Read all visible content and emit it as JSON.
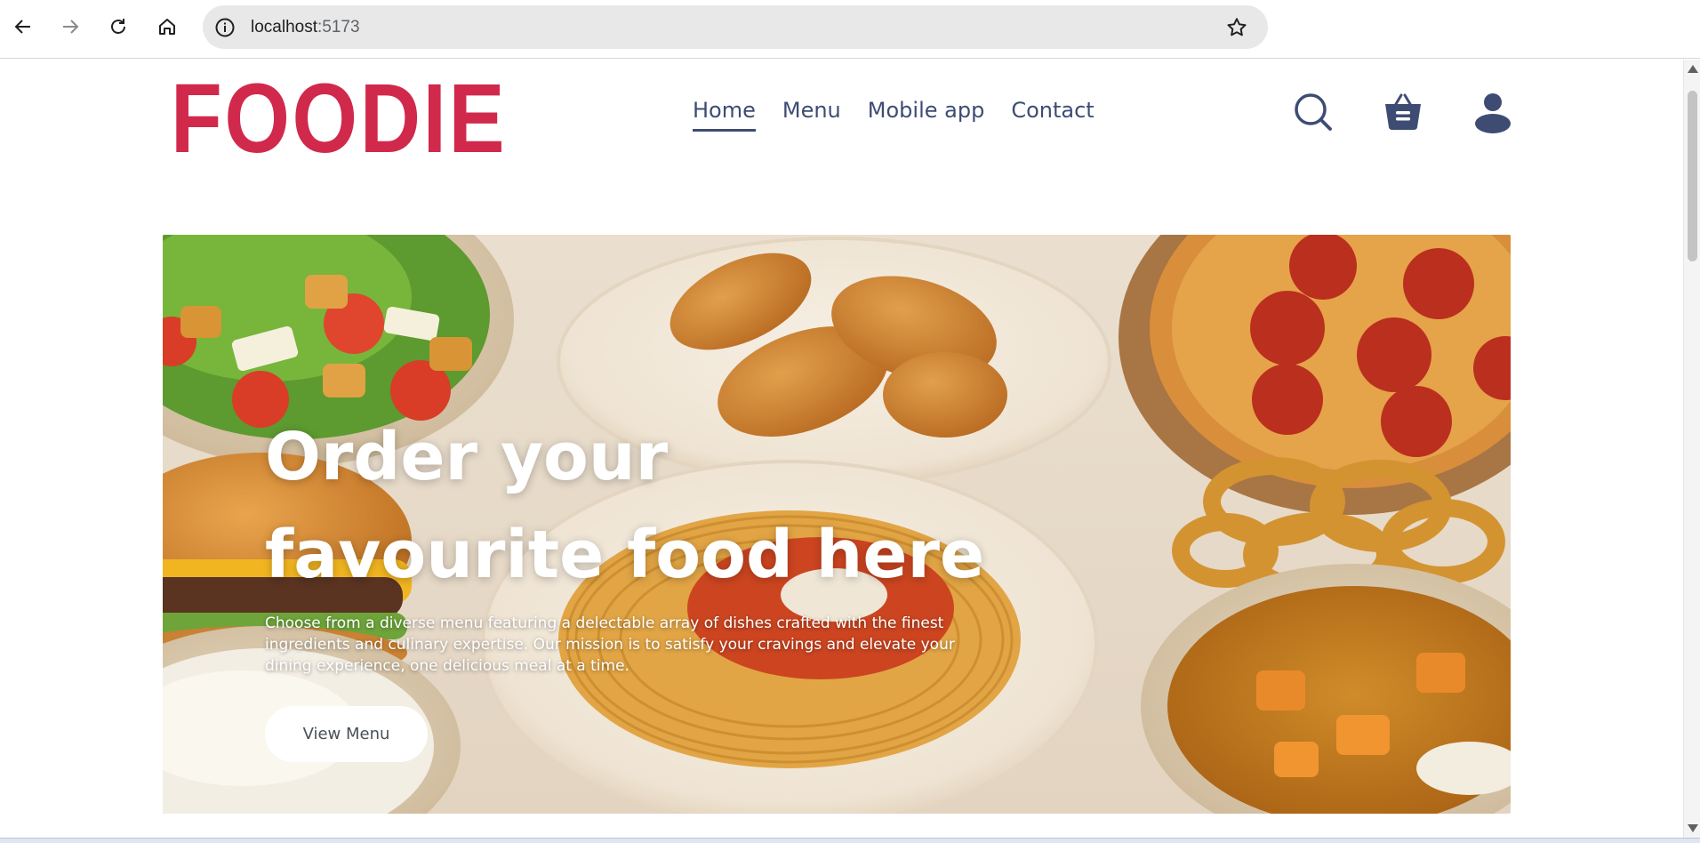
{
  "browser": {
    "url_host": "localhost",
    "url_port": ":5173",
    "icons": [
      "back-arrow-icon",
      "forward-arrow-icon",
      "reload-icon",
      "home-icon",
      "info-icon",
      "star-icon"
    ]
  },
  "header": {
    "logo": "FOODIE",
    "nav": [
      {
        "label": "Home",
        "active": true
      },
      {
        "label": "Menu",
        "active": false
      },
      {
        "label": "Mobile app",
        "active": false
      },
      {
        "label": "Contact",
        "active": false
      }
    ],
    "icons": [
      "search-icon",
      "basket-icon",
      "user-icon"
    ],
    "brand_color": "#d1294b",
    "nav_color": "#3e4c74"
  },
  "hero": {
    "title_line1": "Order your",
    "title_line2": "favourite food here",
    "description": "Choose from a diverse menu featuring a delectable array of dishes crafted with the finest ingredients and culinary expertise. Our mission is to satisfy your cravings and elevate your dining experience, one delicious meal at a time.",
    "button_label": "View Menu"
  }
}
